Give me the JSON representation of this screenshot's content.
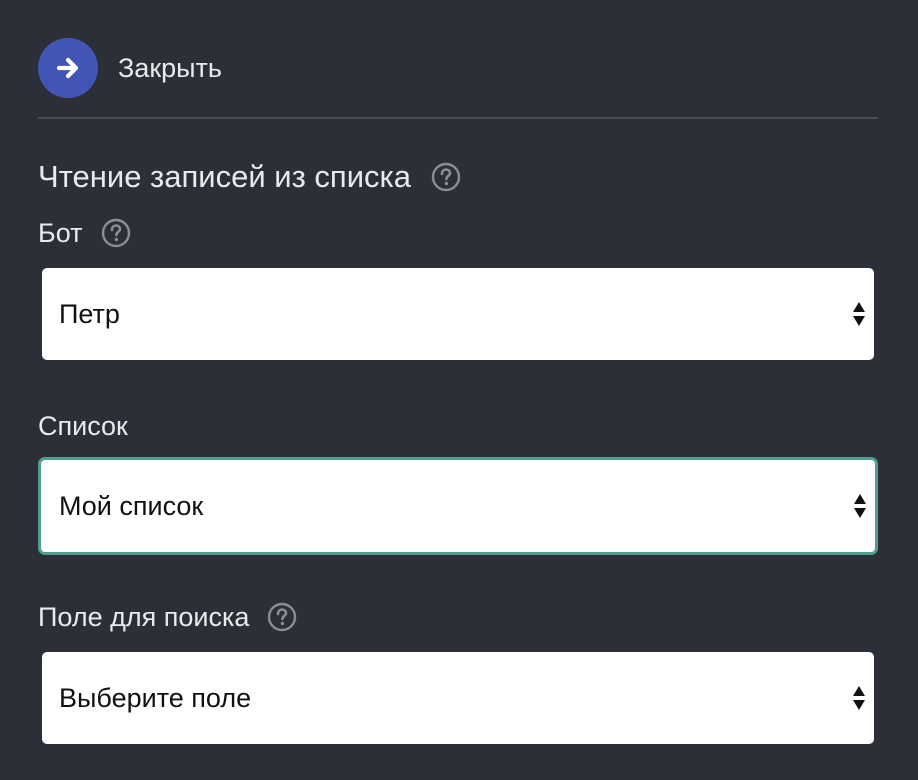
{
  "header": {
    "close_label": "Закрыть"
  },
  "section": {
    "title": "Чтение записей из списка"
  },
  "fields": {
    "bot": {
      "label": "Бот",
      "value": "Петр"
    },
    "list": {
      "label": "Список",
      "value": "Мой список"
    },
    "search_field": {
      "label": "Поле для поиска",
      "value": "Выберите поле"
    }
  },
  "colors": {
    "background": "#2c2f37",
    "close_button": "#4055b5",
    "focus_border": "#4f9e8f",
    "help_icon": "#8b8e96"
  },
  "icons": {
    "close": "arrow-right-icon",
    "help": "question-circle-icon",
    "select": "sort-arrows-icon"
  }
}
